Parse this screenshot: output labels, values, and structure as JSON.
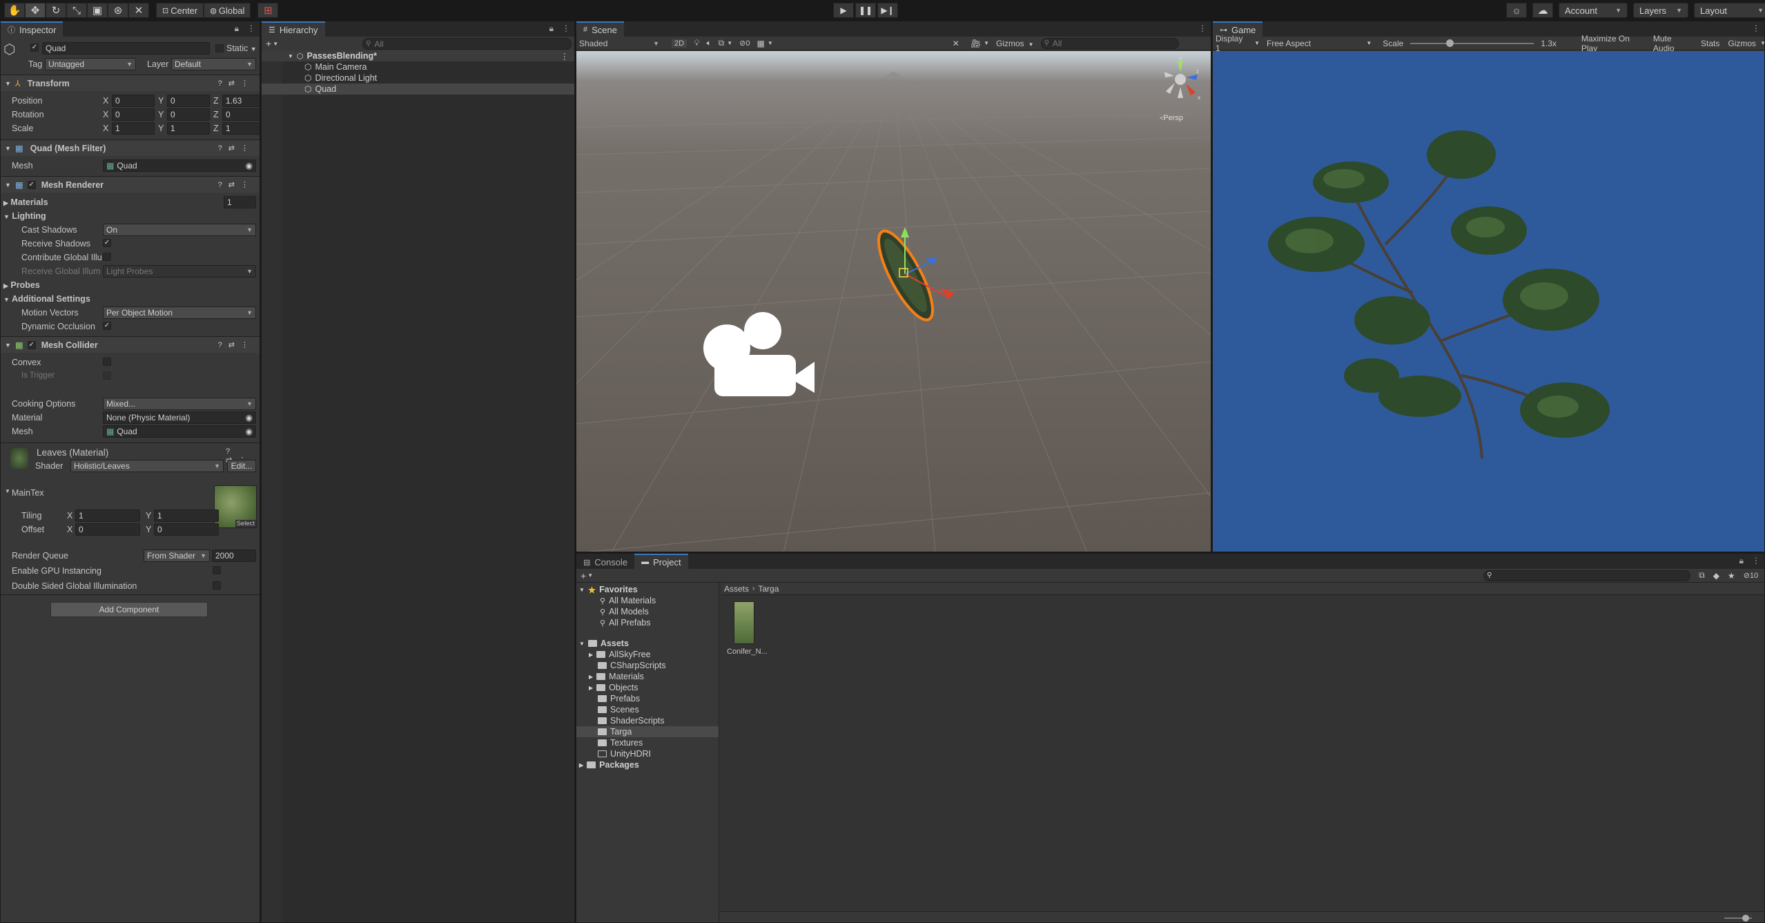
{
  "toolbar": {
    "tools": [
      "hand-tool",
      "move-tool",
      "rotate-tool",
      "scale-tool",
      "rect-tool",
      "transform-tool",
      "custom-tool"
    ],
    "pivot": "Center",
    "space": "Global",
    "account": "Account",
    "layers": "Layers",
    "layout": "Layout"
  },
  "inspector": {
    "tab": "Inspector",
    "object_name": "Quad",
    "static_label": "Static",
    "tag_label": "Tag",
    "tag_value": "Untagged",
    "layer_label": "Layer",
    "layer_value": "Default",
    "transform": {
      "title": "Transform",
      "position": {
        "label": "Position",
        "x": "0",
        "y": "0",
        "z": "1.63"
      },
      "rotation": {
        "label": "Rotation",
        "x": "0",
        "y": "0",
        "z": "0"
      },
      "scale": {
        "label": "Scale",
        "x": "1",
        "y": "1",
        "z": "1"
      }
    },
    "mesh_filter": {
      "title": "Quad (Mesh Filter)",
      "mesh_label": "Mesh",
      "mesh_value": "Quad"
    },
    "mesh_renderer": {
      "title": "Mesh Renderer",
      "materials_label": "Materials",
      "materials_count": "1",
      "lighting": "Lighting",
      "cast_shadows_label": "Cast Shadows",
      "cast_shadows_value": "On",
      "receive_shadows": "Receive Shadows",
      "contribute_gi": "Contribute Global Illu",
      "receive_gi_label": "Receive Global Illum",
      "receive_gi_value": "Light Probes",
      "probes": "Probes",
      "additional": "Additional Settings",
      "motion_vectors_label": "Motion Vectors",
      "motion_vectors_value": "Per Object Motion",
      "dynamic_occlusion": "Dynamic Occlusion"
    },
    "mesh_collider": {
      "title": "Mesh Collider",
      "convex": "Convex",
      "is_trigger": "Is Trigger",
      "cooking_label": "Cooking Options",
      "cooking_value": "Mixed...",
      "material_label": "Material",
      "material_value": "None (Physic Material)",
      "mesh_label": "Mesh",
      "mesh_value": "Quad"
    },
    "material": {
      "title": "Leaves (Material)",
      "shader_label": "Shader",
      "shader_value": "Holistic/Leaves",
      "edit": "Edit...",
      "maintex": "MainTex",
      "tiling_label": "Tiling",
      "tiling_x": "1",
      "tiling_y": "1",
      "offset_label": "Offset",
      "offset_x": "0",
      "offset_y": "0",
      "select": "Select",
      "render_queue_label": "Render Queue",
      "render_queue_mode": "From Shader",
      "render_queue_value": "2000",
      "gpu_instancing": "Enable GPU Instancing",
      "double_sided_gi": "Double Sided Global Illumination"
    },
    "add_component": "Add Component"
  },
  "hierarchy": {
    "tab": "Hierarchy",
    "search_placeholder": "All",
    "scene": "PassesBlending*",
    "items": [
      "Main Camera",
      "Directional Light",
      "Quad"
    ]
  },
  "scene": {
    "tab": "Scene",
    "shading": "Shaded",
    "mode2d": "2D",
    "hidden_count": "0",
    "gizmos": "Gizmos",
    "search_placeholder": "All",
    "persp": "Persp",
    "axis_y": "y",
    "axis_z": "z",
    "axis_x": "x"
  },
  "game": {
    "tab": "Game",
    "display": "Display 1",
    "aspect": "Free Aspect",
    "scale_label": "Scale",
    "scale_value": "1.3x",
    "maximize": "Maximize On Play",
    "mute": "Mute Audio",
    "stats": "Stats",
    "gizmos": "Gizmos"
  },
  "bottom": {
    "console_tab": "Console",
    "project_tab": "Project",
    "hidden_count": "10",
    "favorites": "Favorites",
    "favorite_items": [
      "All Materials",
      "All Models",
      "All Prefabs"
    ],
    "assets": "Assets",
    "folders": [
      "AllSkyFree",
      "CSharpScripts",
      "Materials",
      "Objects",
      "Prefabs",
      "Scenes",
      "ShaderScripts",
      "Targa",
      "Textures",
      "UnityHDRI"
    ],
    "packages": "Packages",
    "breadcrumb": [
      "Assets",
      "Targa"
    ],
    "asset_name": "Conifer_N..."
  },
  "colors": {
    "accent": "#3a79bb",
    "selection_orange": "#f57f17",
    "game_sky": "#2e5a9c"
  }
}
